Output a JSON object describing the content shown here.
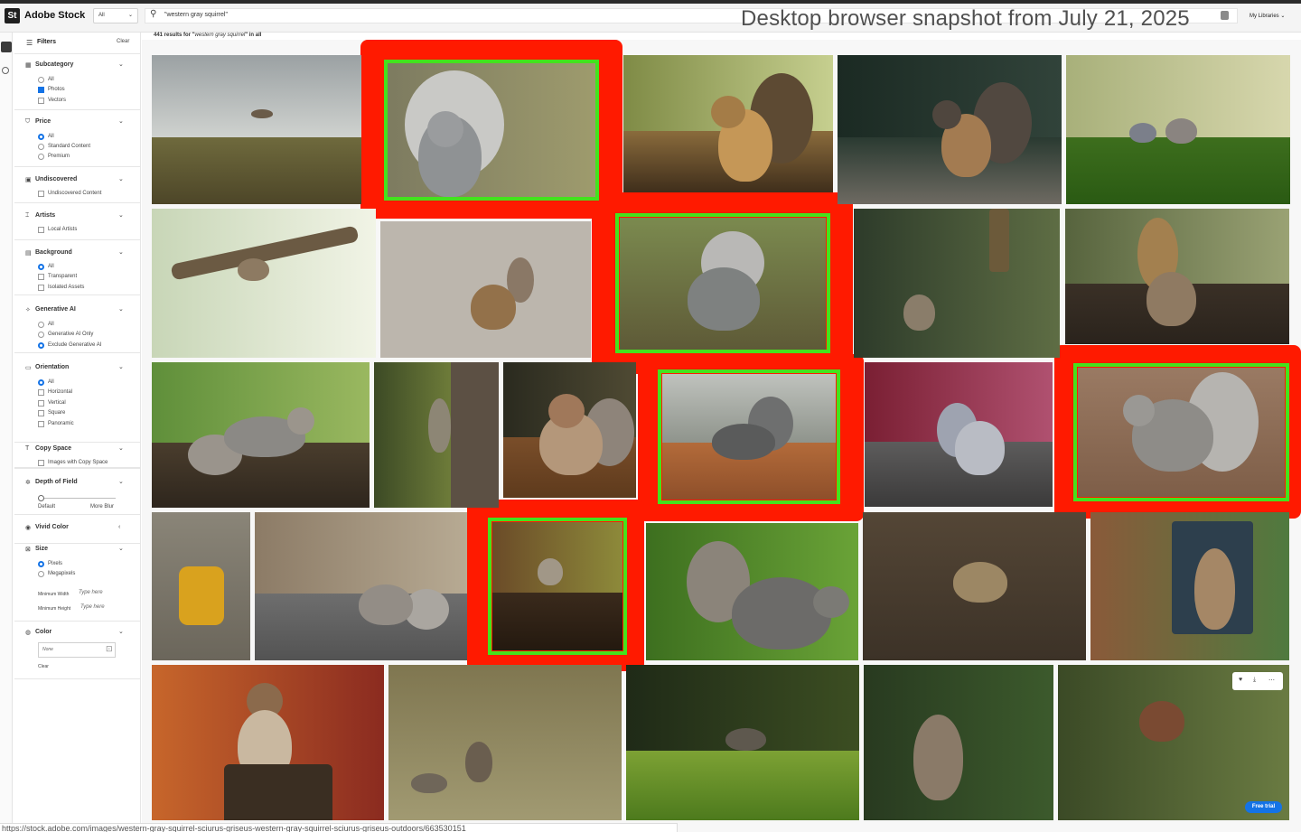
{
  "header": {
    "logo_text": "St",
    "brand": "Adobe Stock",
    "scope_value": "All",
    "search_value": "\"western gray squirrel\"",
    "caption": "Desktop browser snapshot from July 21, 2025",
    "my_libraries": "My Libraries"
  },
  "sidebar": {
    "filters_title": "Filters",
    "clear_all": "Clear",
    "subcategory": {
      "title": "Subcategory",
      "options": [
        "All",
        "Photos",
        "Vectors"
      ]
    },
    "price": {
      "title": "Price",
      "options": [
        "All",
        "Standard Content",
        "Premium"
      ]
    },
    "undiscovered": {
      "title": "Undiscovered",
      "options": [
        "Undiscovered Content"
      ]
    },
    "artists": {
      "title": "Artists",
      "options": [
        "Local Artists"
      ]
    },
    "background": {
      "title": "Background",
      "options": [
        "All",
        "Transparent",
        "Isolated Assets"
      ]
    },
    "generative_ai": {
      "title": "Generative AI",
      "options": [
        "All",
        "Generative AI Only",
        "Exclude Generative AI"
      ]
    },
    "orientation": {
      "title": "Orientation",
      "options": [
        "All",
        "Horizontal",
        "Vertical",
        "Square",
        "Panoramic"
      ]
    },
    "copy_space": {
      "title": "Copy Space",
      "options": [
        "Images with Copy Space"
      ]
    },
    "depth_of_field": {
      "title": "Depth of Field",
      "min_label": "Default",
      "max_label": "More Blur"
    },
    "vivid_color": {
      "title": "Vivid Color"
    },
    "size": {
      "title": "Size",
      "options": [
        "Pixels",
        "Megapixels"
      ],
      "min_width_label": "Minimum Width",
      "min_width_placeholder": "Type here",
      "min_height_label": "Minimum Height",
      "min_height_placeholder": "Type here"
    },
    "color": {
      "title": "Color",
      "value": "None",
      "clear": "Clear"
    }
  },
  "results": {
    "count_prefix": "441 results for ",
    "query": "western gray squirrel",
    "count_suffix": " in all"
  },
  "hover_tools": {
    "free_trial": "Free trial"
  },
  "status_url": "https://stock.adobe.com/images/western-gray-squirrel-sciurus-griseus-western-gray-squirrel-sciurus-griseus-outdoors/663530151",
  "colors": {
    "accent": "#1473e6",
    "highlight_red": "#ff1a00",
    "highlight_green": "#44e21d"
  }
}
